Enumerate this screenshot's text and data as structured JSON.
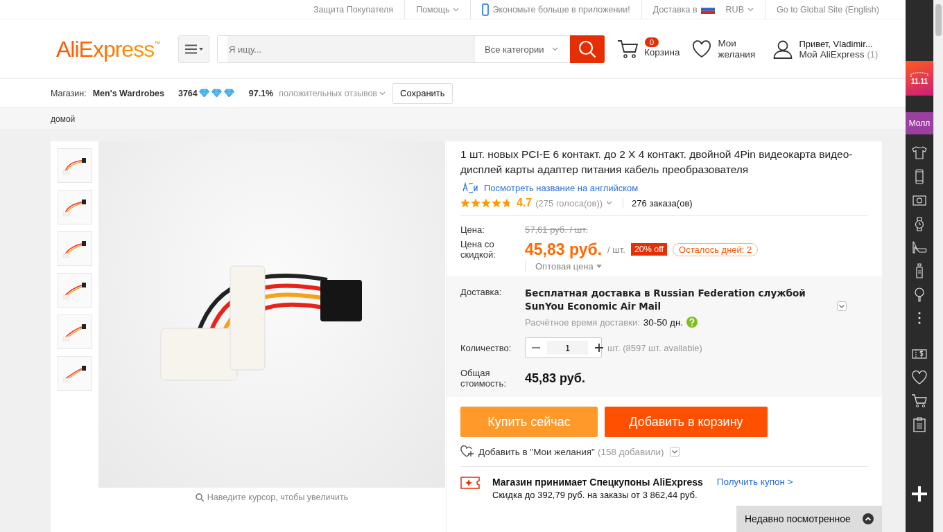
{
  "top_bar": [
    {
      "kind": "link",
      "text": "Защита Покупателя"
    },
    {
      "kind": "dropdown",
      "text": "Помощь"
    },
    {
      "kind": "app",
      "text": "Экономьте больше в приложении!"
    },
    {
      "kind": "shipping",
      "text": "Доставка в",
      "currency": "RUB"
    },
    {
      "kind": "link",
      "text": "Go to Global Site (English)"
    }
  ],
  "header": {
    "logo": "AliExpress",
    "logo_mark": "™",
    "search": {
      "placeholder": "Я ищу...",
      "category": "Все категории"
    },
    "cart": {
      "count": "0",
      "label": "Корзина"
    },
    "wishlist": {
      "label": "Мои желания"
    },
    "account": {
      "greeting": "Привет, Vladimir...",
      "link": "Мой AliExpress",
      "count": "(1)"
    }
  },
  "store_bar": {
    "label": "Магазин:",
    "name": "Men's Wardrobes",
    "score": "3764",
    "positive": "97.1%",
    "feedback": "положительных отзывов",
    "save": "Сохранить"
  },
  "breadcrumb": [
    "домой"
  ],
  "gallery": {
    "hint": "Наведите курсор, чтобы увеличить"
  },
  "product": {
    "title": "1 шт. новых PCI-E 6 контакт. до 2 X 4 контакт. двойной 4Pin видеокарта видео-дисплей карты адаптер питания кабель преобразователя",
    "translate": "Посмотреть название на английском",
    "stars": 4.7,
    "rating": "4.7",
    "votes": "(275 голоса(ов))",
    "orders": "276 заказа(ов)",
    "price_label": "Цена:",
    "old_price": "57,61 руб. / шт.",
    "discount_label": "Цена со скидкой:",
    "price": "45,83 руб.",
    "unit": "/ шт.",
    "discount": "20% off",
    "days_left": "Осталось дней: 2",
    "wholesale": "Оптовая цена",
    "shipping_label": "Доставка:",
    "shipping": "Бесплатная доставка в Russian Federation службой SunYou Economic Air Mail",
    "estimate_label": "Расчётное время доставки:",
    "estimate": "30-50 дн.",
    "quantity_label": "Количество:",
    "quantity": "1",
    "available": "шт. (8597 шт. available)",
    "total_label": "Общая стоимость:",
    "total": "45,83 руб.",
    "buy": "Купить сейчас",
    "add_to_cart": "Добавить в корзину",
    "wishlist": "Добавить в \"Мои желания\"",
    "wishlist_count": "(158 добавили)",
    "coupon_title": "Магазин принимает Спецкупоны AliExpress",
    "coupon_text": "Скидка до 392,79 руб. на заказы от 3 862,44 руб.",
    "coupon_link": "Получить купон >"
  },
  "recently_viewed": "Недавно посмотренное",
  "side_bar": {
    "promo": "11.11",
    "mall": "Молл"
  }
}
